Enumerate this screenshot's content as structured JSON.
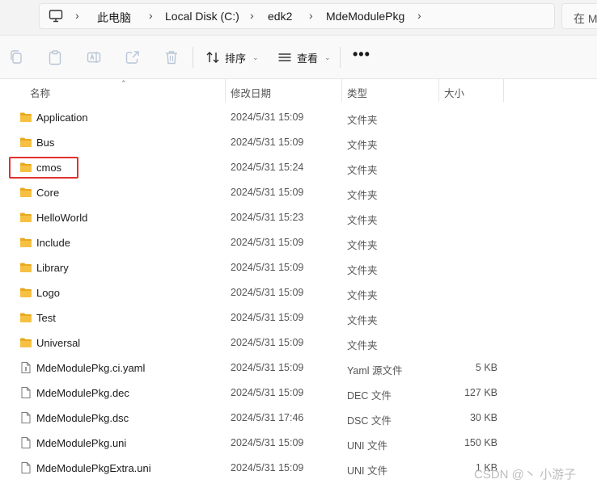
{
  "address_bar": {
    "crumbs": [
      "此电脑",
      "Local Disk (C:)",
      "edk2",
      "MdeModulePkg"
    ],
    "search_text": "在 M"
  },
  "toolbar": {
    "sort_label": "排序",
    "view_label": "查看",
    "more_label": "•••"
  },
  "columns": {
    "name": "名称",
    "date": "修改日期",
    "type": "类型",
    "size": "大小"
  },
  "files": [
    {
      "name": "Application",
      "date": "2024/5/31 15:09",
      "type": "文件夹",
      "size": "",
      "kind": "folder"
    },
    {
      "name": "Bus",
      "date": "2024/5/31 15:09",
      "type": "文件夹",
      "size": "",
      "kind": "folder"
    },
    {
      "name": "cmos",
      "date": "2024/5/31 15:24",
      "type": "文件夹",
      "size": "",
      "kind": "folder"
    },
    {
      "name": "Core",
      "date": "2024/5/31 15:09",
      "type": "文件夹",
      "size": "",
      "kind": "folder"
    },
    {
      "name": "HelloWorld",
      "date": "2024/5/31 15:23",
      "type": "文件夹",
      "size": "",
      "kind": "folder"
    },
    {
      "name": "Include",
      "date": "2024/5/31 15:09",
      "type": "文件夹",
      "size": "",
      "kind": "folder"
    },
    {
      "name": "Library",
      "date": "2024/5/31 15:09",
      "type": "文件夹",
      "size": "",
      "kind": "folder"
    },
    {
      "name": "Logo",
      "date": "2024/5/31 15:09",
      "type": "文件夹",
      "size": "",
      "kind": "folder"
    },
    {
      "name": "Test",
      "date": "2024/5/31 15:09",
      "type": "文件夹",
      "size": "",
      "kind": "folder"
    },
    {
      "name": "Universal",
      "date": "2024/5/31 15:09",
      "type": "文件夹",
      "size": "",
      "kind": "folder"
    },
    {
      "name": "MdeModulePkg.ci.yaml",
      "date": "2024/5/31 15:09",
      "type": "Yaml 源文件",
      "size": "5 KB",
      "kind": "yaml"
    },
    {
      "name": "MdeModulePkg.dec",
      "date": "2024/5/31 15:09",
      "type": "DEC 文件",
      "size": "127 KB",
      "kind": "file"
    },
    {
      "name": "MdeModulePkg.dsc",
      "date": "2024/5/31 17:46",
      "type": "DSC 文件",
      "size": "30 KB",
      "kind": "file"
    },
    {
      "name": "MdeModulePkg.uni",
      "date": "2024/5/31 15:09",
      "type": "UNI 文件",
      "size": "150 KB",
      "kind": "file"
    },
    {
      "name": "MdeModulePkgExtra.uni",
      "date": "2024/5/31 15:09",
      "type": "UNI 文件",
      "size": "1 KB",
      "kind": "file"
    }
  ],
  "watermark": "CSDN @丶 小游子",
  "colors": {
    "folder": "#f6c142",
    "highlight": "#e0322d"
  }
}
